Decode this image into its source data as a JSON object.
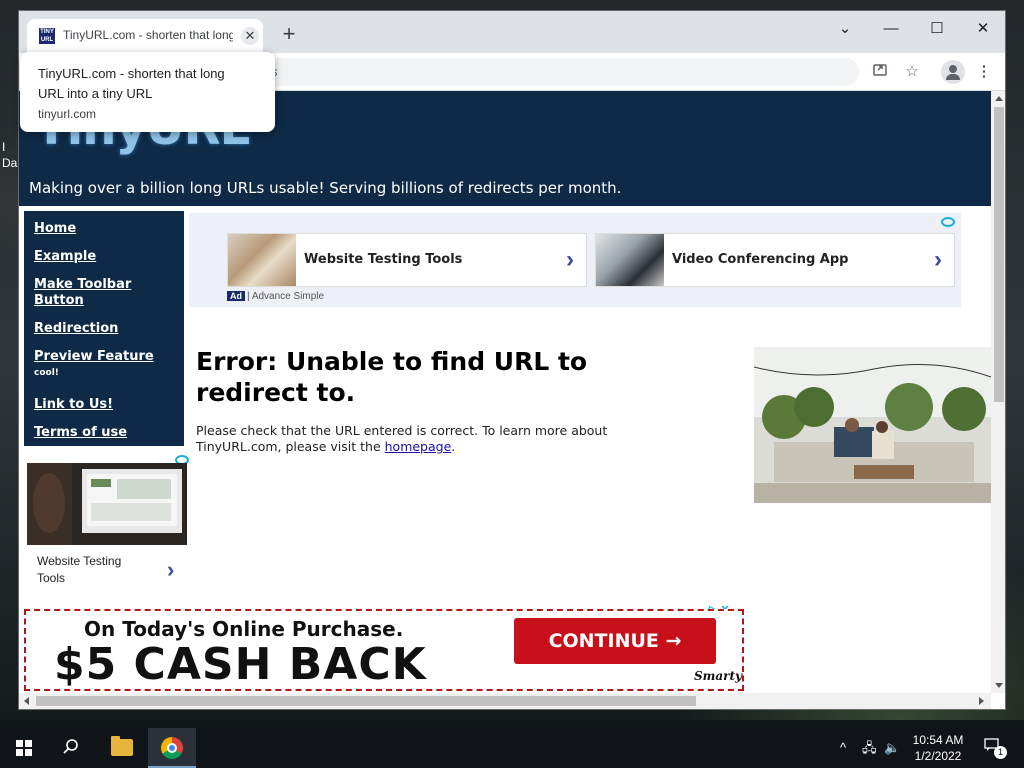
{
  "browser": {
    "tab_title": "TinyURL.com - shorten that long URL into a tiny URL",
    "tab_favicon_text": "TINY URL",
    "close_glyph": "✕",
    "new_tab_glyph": "+",
    "url_fragment": "s",
    "window_controls": {
      "chevron": "⌄",
      "minimize": "—",
      "maximize": "☐",
      "close": "✕"
    },
    "toolbar_icons": [
      "share-icon",
      "star-icon",
      "profile-icon",
      "menu-icon"
    ]
  },
  "tooltip": {
    "title": "TinyURL.com - shorten that long URL into a tiny URL",
    "host": "tinyurl.com"
  },
  "site": {
    "logo": "TinyURL",
    "tagline": "Making over a billion long URLs usable! Serving billions of redirects per month.",
    "nav": [
      {
        "label": "Home"
      },
      {
        "label": "Example"
      },
      {
        "label": "Make Toolbar Button"
      },
      {
        "label": "Redirection"
      },
      {
        "label": "Preview Feature",
        "sup": "cool!"
      },
      {
        "label": "Link to Us!"
      },
      {
        "label": "Terms of use"
      }
    ]
  },
  "top_ad": {
    "cards": [
      {
        "label": "Website Testing Tools"
      },
      {
        "label": "Video Conferencing App"
      }
    ],
    "badge": "Ad",
    "attribution": "| Advance Simple"
  },
  "error": {
    "title": "Error: Unable to find URL to redirect to.",
    "text_before": "Please check that the URL entered is correct. To learn more about TinyURL.com, please visit the ",
    "link": "homepage",
    "text_after": "."
  },
  "side_ad": {
    "label": "Website Testing Tools",
    "chevron": "›"
  },
  "bottom_ad": {
    "line1": "On Today's Online Purchase.",
    "line2": "$5 CASH BACK",
    "cta": "CONTINUE →",
    "brand": "Smarty",
    "choices": "▷ ✕"
  },
  "desktop": {
    "icon_labels": [
      "I",
      "Da"
    ]
  },
  "taskbar": {
    "time": "10:54 AM",
    "date": "1/2/2022",
    "notification_count": "1",
    "tray": {
      "chevron": "^",
      "network": "🖧",
      "volume": "🔈"
    }
  },
  "colors": {
    "site_navy": "#0e2a47",
    "cta_red": "#c8101a",
    "ad_chevron": "#3b4aa6"
  }
}
